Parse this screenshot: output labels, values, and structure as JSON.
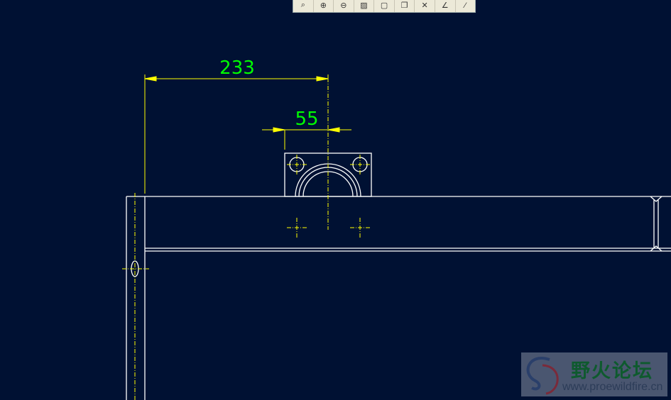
{
  "toolbar": {
    "buttons": [
      {
        "icon": "zoom-fit-icon",
        "glyph": "⌕"
      },
      {
        "icon": "zoom-in-icon",
        "glyph": "⊕"
      },
      {
        "icon": "zoom-out-icon",
        "glyph": "⊖"
      },
      {
        "icon": "repaint-icon",
        "glyph": "▨"
      },
      {
        "icon": "view-display-icon",
        "glyph": "▢"
      },
      {
        "icon": "saved-views-icon",
        "glyph": "❐"
      },
      {
        "icon": "datum-display-icon",
        "glyph": "✕"
      },
      {
        "icon": "axis-display-icon",
        "glyph": "∠"
      },
      {
        "icon": "point-display-icon",
        "glyph": "⁄"
      }
    ]
  },
  "drawing": {
    "dimensions": [
      "233",
      "55"
    ],
    "colors": {
      "background": "#001133",
      "geometry": "#ffffff",
      "dimension": "#ffff00",
      "dimension_text": "#00ff00"
    }
  },
  "watermark": {
    "title": "野火论坛",
    "url": "www.proewildfire.cn"
  }
}
